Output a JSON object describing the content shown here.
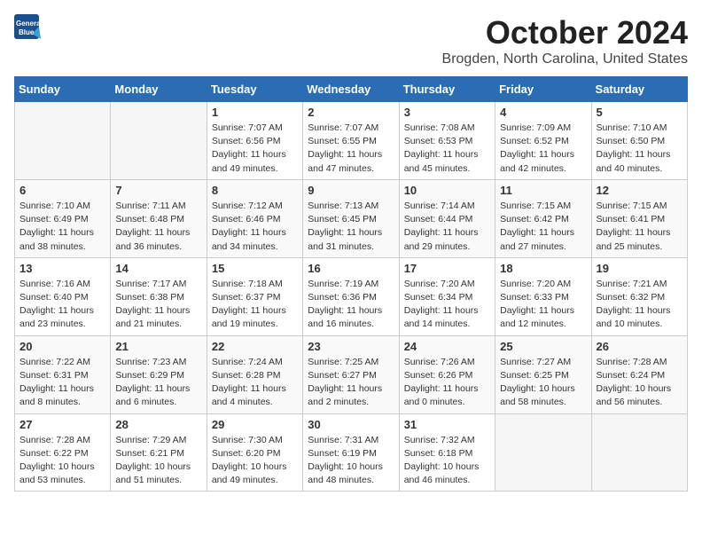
{
  "header": {
    "logo_line1": "General",
    "logo_line2": "Blue",
    "month": "October 2024",
    "location": "Brogden, North Carolina, United States"
  },
  "weekdays": [
    "Sunday",
    "Monday",
    "Tuesday",
    "Wednesday",
    "Thursday",
    "Friday",
    "Saturday"
  ],
  "weeks": [
    [
      {
        "day": "",
        "empty": true
      },
      {
        "day": "",
        "empty": true
      },
      {
        "day": "1",
        "sunrise": "Sunrise: 7:07 AM",
        "sunset": "Sunset: 6:56 PM",
        "daylight": "Daylight: 11 hours and 49 minutes."
      },
      {
        "day": "2",
        "sunrise": "Sunrise: 7:07 AM",
        "sunset": "Sunset: 6:55 PM",
        "daylight": "Daylight: 11 hours and 47 minutes."
      },
      {
        "day": "3",
        "sunrise": "Sunrise: 7:08 AM",
        "sunset": "Sunset: 6:53 PM",
        "daylight": "Daylight: 11 hours and 45 minutes."
      },
      {
        "day": "4",
        "sunrise": "Sunrise: 7:09 AM",
        "sunset": "Sunset: 6:52 PM",
        "daylight": "Daylight: 11 hours and 42 minutes."
      },
      {
        "day": "5",
        "sunrise": "Sunrise: 7:10 AM",
        "sunset": "Sunset: 6:50 PM",
        "daylight": "Daylight: 11 hours and 40 minutes."
      }
    ],
    [
      {
        "day": "6",
        "sunrise": "Sunrise: 7:10 AM",
        "sunset": "Sunset: 6:49 PM",
        "daylight": "Daylight: 11 hours and 38 minutes."
      },
      {
        "day": "7",
        "sunrise": "Sunrise: 7:11 AM",
        "sunset": "Sunset: 6:48 PM",
        "daylight": "Daylight: 11 hours and 36 minutes."
      },
      {
        "day": "8",
        "sunrise": "Sunrise: 7:12 AM",
        "sunset": "Sunset: 6:46 PM",
        "daylight": "Daylight: 11 hours and 34 minutes."
      },
      {
        "day": "9",
        "sunrise": "Sunrise: 7:13 AM",
        "sunset": "Sunset: 6:45 PM",
        "daylight": "Daylight: 11 hours and 31 minutes."
      },
      {
        "day": "10",
        "sunrise": "Sunrise: 7:14 AM",
        "sunset": "Sunset: 6:44 PM",
        "daylight": "Daylight: 11 hours and 29 minutes."
      },
      {
        "day": "11",
        "sunrise": "Sunrise: 7:15 AM",
        "sunset": "Sunset: 6:42 PM",
        "daylight": "Daylight: 11 hours and 27 minutes."
      },
      {
        "day": "12",
        "sunrise": "Sunrise: 7:15 AM",
        "sunset": "Sunset: 6:41 PM",
        "daylight": "Daylight: 11 hours and 25 minutes."
      }
    ],
    [
      {
        "day": "13",
        "sunrise": "Sunrise: 7:16 AM",
        "sunset": "Sunset: 6:40 PM",
        "daylight": "Daylight: 11 hours and 23 minutes."
      },
      {
        "day": "14",
        "sunrise": "Sunrise: 7:17 AM",
        "sunset": "Sunset: 6:38 PM",
        "daylight": "Daylight: 11 hours and 21 minutes."
      },
      {
        "day": "15",
        "sunrise": "Sunrise: 7:18 AM",
        "sunset": "Sunset: 6:37 PM",
        "daylight": "Daylight: 11 hours and 19 minutes."
      },
      {
        "day": "16",
        "sunrise": "Sunrise: 7:19 AM",
        "sunset": "Sunset: 6:36 PM",
        "daylight": "Daylight: 11 hours and 16 minutes."
      },
      {
        "day": "17",
        "sunrise": "Sunrise: 7:20 AM",
        "sunset": "Sunset: 6:34 PM",
        "daylight": "Daylight: 11 hours and 14 minutes."
      },
      {
        "day": "18",
        "sunrise": "Sunrise: 7:20 AM",
        "sunset": "Sunset: 6:33 PM",
        "daylight": "Daylight: 11 hours and 12 minutes."
      },
      {
        "day": "19",
        "sunrise": "Sunrise: 7:21 AM",
        "sunset": "Sunset: 6:32 PM",
        "daylight": "Daylight: 11 hours and 10 minutes."
      }
    ],
    [
      {
        "day": "20",
        "sunrise": "Sunrise: 7:22 AM",
        "sunset": "Sunset: 6:31 PM",
        "daylight": "Daylight: 11 hours and 8 minutes."
      },
      {
        "day": "21",
        "sunrise": "Sunrise: 7:23 AM",
        "sunset": "Sunset: 6:29 PM",
        "daylight": "Daylight: 11 hours and 6 minutes."
      },
      {
        "day": "22",
        "sunrise": "Sunrise: 7:24 AM",
        "sunset": "Sunset: 6:28 PM",
        "daylight": "Daylight: 11 hours and 4 minutes."
      },
      {
        "day": "23",
        "sunrise": "Sunrise: 7:25 AM",
        "sunset": "Sunset: 6:27 PM",
        "daylight": "Daylight: 11 hours and 2 minutes."
      },
      {
        "day": "24",
        "sunrise": "Sunrise: 7:26 AM",
        "sunset": "Sunset: 6:26 PM",
        "daylight": "Daylight: 11 hours and 0 minutes."
      },
      {
        "day": "25",
        "sunrise": "Sunrise: 7:27 AM",
        "sunset": "Sunset: 6:25 PM",
        "daylight": "Daylight: 10 hours and 58 minutes."
      },
      {
        "day": "26",
        "sunrise": "Sunrise: 7:28 AM",
        "sunset": "Sunset: 6:24 PM",
        "daylight": "Daylight: 10 hours and 56 minutes."
      }
    ],
    [
      {
        "day": "27",
        "sunrise": "Sunrise: 7:28 AM",
        "sunset": "Sunset: 6:22 PM",
        "daylight": "Daylight: 10 hours and 53 minutes."
      },
      {
        "day": "28",
        "sunrise": "Sunrise: 7:29 AM",
        "sunset": "Sunset: 6:21 PM",
        "daylight": "Daylight: 10 hours and 51 minutes."
      },
      {
        "day": "29",
        "sunrise": "Sunrise: 7:30 AM",
        "sunset": "Sunset: 6:20 PM",
        "daylight": "Daylight: 10 hours and 49 minutes."
      },
      {
        "day": "30",
        "sunrise": "Sunrise: 7:31 AM",
        "sunset": "Sunset: 6:19 PM",
        "daylight": "Daylight: 10 hours and 48 minutes."
      },
      {
        "day": "31",
        "sunrise": "Sunrise: 7:32 AM",
        "sunset": "Sunset: 6:18 PM",
        "daylight": "Daylight: 10 hours and 46 minutes."
      },
      {
        "day": "",
        "empty": true
      },
      {
        "day": "",
        "empty": true
      }
    ]
  ]
}
